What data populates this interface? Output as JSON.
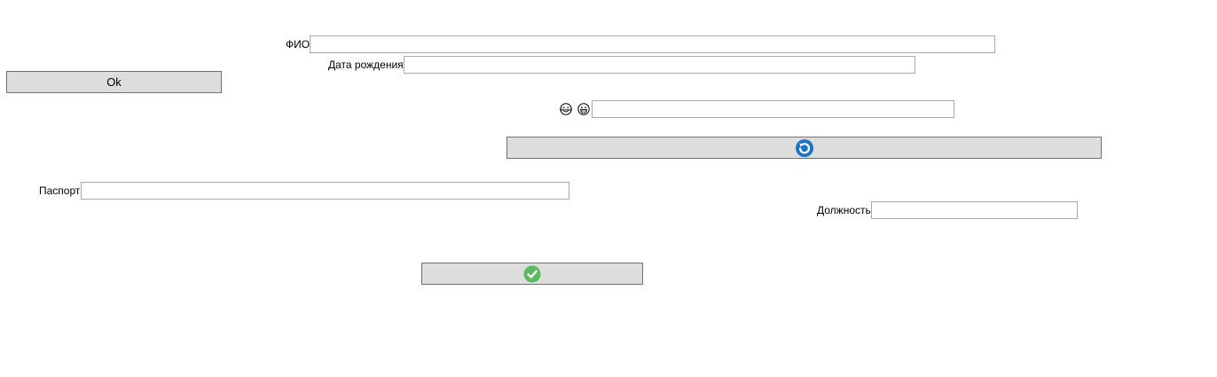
{
  "form": {
    "fio_label": "ФИО",
    "fio_value": "",
    "birthdate_label": "Дата рождения",
    "birthdate_value": "",
    "emoji_field_value": "",
    "passport_label": "Паспорт",
    "passport_value": "",
    "position_label": "Должность",
    "position_value": ""
  },
  "buttons": {
    "ok_label": "Ok",
    "refresh_icon": "refresh-icon",
    "confirm_icon": "checkmark-icon"
  },
  "icons": {
    "emoji_left": "crying-laughing-face-icon",
    "emoji_right": "grinning-face-icon"
  },
  "colors": {
    "button_bg": "#dddddd",
    "refresh_icon": "#1e73c8",
    "confirm_icon": "#5cb85c"
  }
}
